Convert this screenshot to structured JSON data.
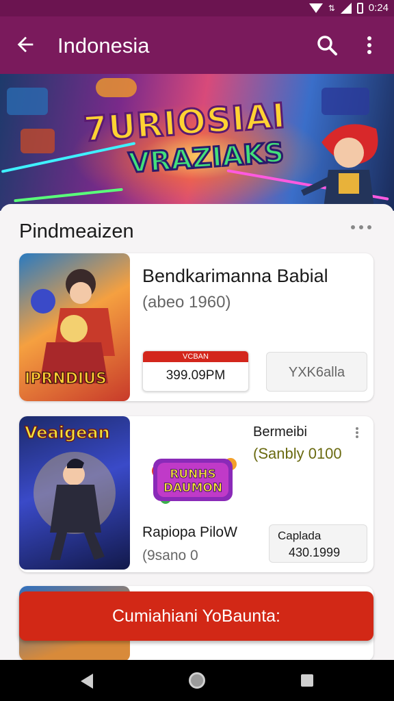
{
  "status_bar": {
    "time": "0:24",
    "icons": [
      "wifi-icon",
      "signal-icon",
      "battery-icon"
    ]
  },
  "app_bar": {
    "title": "Indonesia",
    "icons": [
      "back-arrow-icon",
      "search-icon",
      "more-vert-icon"
    ]
  },
  "hero": {
    "line1": "7URIOSIAI",
    "line2": "VRAZIAKS"
  },
  "section": {
    "title": "Pindmeaizen"
  },
  "cards": [
    {
      "title": "Bendkarimanna Babial",
      "subtitle": "(abeo 1960)",
      "thumb_label": "IPRNDIUS",
      "price_tag": "VCBAN",
      "price": "399.09PM",
      "action_label": "YXK6alla"
    },
    {
      "title": "Bermeibi",
      "subtitle": "(Sanbly 0100",
      "thumb_label": "Veaigean",
      "logo_label": "RUNHS DAUMON",
      "name": "Rapiopa PiloW",
      "meta": "(9sano 0",
      "price_label": "Caplada",
      "price": "430.1999"
    }
  ],
  "cta": {
    "label": "Cumiahiani YoBaunta:"
  },
  "colors": {
    "app_bar": "#7a1a5c",
    "cta": "#d22816",
    "price_tag": "#d3261c"
  }
}
